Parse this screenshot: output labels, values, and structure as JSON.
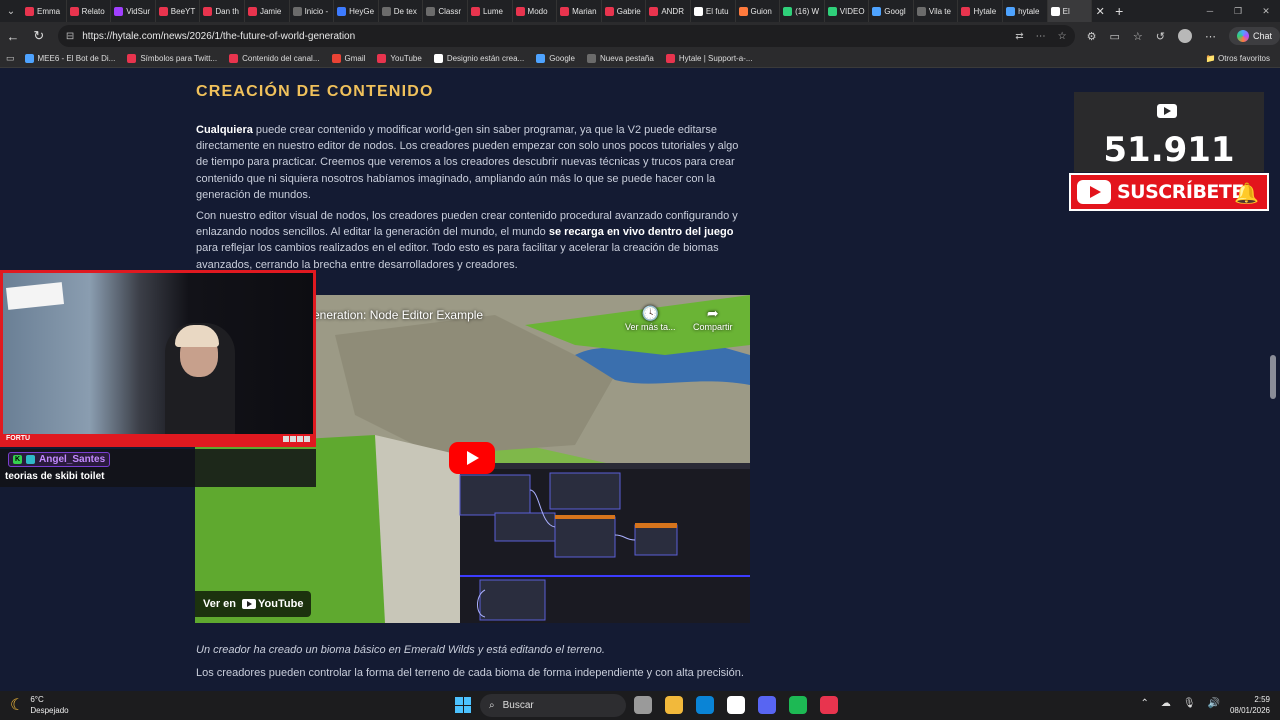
{
  "browser": {
    "tabs": [
      {
        "label": "Emma",
        "color": "#e8344e"
      },
      {
        "label": "Relato",
        "color": "#e8344e"
      },
      {
        "label": "VidSur",
        "color": "#a13fff"
      },
      {
        "label": "BeeYT",
        "color": "#e8344e"
      },
      {
        "label": "Dan th",
        "color": "#e8344e"
      },
      {
        "label": "Jamie",
        "color": "#e8344e"
      },
      {
        "label": "Inicio -",
        "color": "#6b6b6b"
      },
      {
        "label": "HeyGe",
        "color": "#3d7bff"
      },
      {
        "label": "De tex",
        "color": "#6b6b6b"
      },
      {
        "label": "Classr",
        "color": "#6b6b6b"
      },
      {
        "label": "Lume",
        "color": "#e8344e"
      },
      {
        "label": "Modo",
        "color": "#e8344e"
      },
      {
        "label": "Marian",
        "color": "#e8344e"
      },
      {
        "label": "Gabrie",
        "color": "#e8344e"
      },
      {
        "label": "ANDR",
        "color": "#e8344e"
      },
      {
        "label": "El futu",
        "color": "#ffffff"
      },
      {
        "label": "Guion",
        "color": "#ff7a3d"
      },
      {
        "label": "(16) W",
        "color": "#2fd07a"
      },
      {
        "label": "VIDEO",
        "color": "#2fd07a"
      },
      {
        "label": "Googl",
        "color": "#4ea3ff"
      },
      {
        "label": "Vila te",
        "color": "#6b6b6b"
      },
      {
        "label": "Hytale",
        "color": "#e8344e"
      },
      {
        "label": "hytale",
        "color": "#4ea3ff"
      },
      {
        "label": "El",
        "color": "#ffffff"
      }
    ],
    "url": "https://hytale.com/news/2026/1/the-future-of-world-generation",
    "chat_label": "Chat",
    "bookmarks": [
      {
        "label": "MEE6 - El Bot de Di...",
        "color": "#4ea3ff"
      },
      {
        "label": "Símbolos para Twitt...",
        "color": "#e8344e"
      },
      {
        "label": "Contenido del canal...",
        "color": "#e8344e"
      },
      {
        "label": "Gmail",
        "color": "#ea4335"
      },
      {
        "label": "YouTube",
        "color": "#e8344e"
      },
      {
        "label": "Designio están crea...",
        "color": "#ffffff"
      },
      {
        "label": "Google",
        "color": "#4ea3ff"
      },
      {
        "label": "Nueva pestaña",
        "color": "#6b6b6b"
      },
      {
        "label": "Hytale | Support-a-...",
        "color": "#e8344e"
      }
    ],
    "other_favorites": "Otros favoritos"
  },
  "article": {
    "heading": "CREACIÓN DE CONTENIDO",
    "para1_bold": "Cualquiera",
    "para1_rest": " puede crear contenido y modificar world-gen sin saber programar, ya que la V2 puede editarse directamente en nuestro editor de nodos. Los creadores pueden empezar con solo unos pocos tutoriales y algo de tiempo para practicar. Creemos que veremos a los creadores descubrir nuevas técnicas y trucos para crear contenido que ni siquiera nosotros habíamos imaginado, ampliando aún más lo que se puede hacer con la generación de mundos.",
    "para2_a": "Con nuestro editor visual de nodos, los creadores pueden crear contenido procedural avanzado configurando y enlazando nodos sencillos. Al editar la generación del mundo, el mundo ",
    "para2_bold": "se recarga en vivo dentro del juego",
    "para2_b": " para reflejar los cambios realizados en el editor. Todo esto es para facilitar y acelerar la creación de biomas avanzados, cerrando la brecha entre desarrolladores y creadores.",
    "caption": "Un creador ha creado un bioma básico en Emerald Wilds y está editando el terreno.",
    "para3": "Los creadores pueden controlar la forma del terreno de cada bioma de forma independiente y con alta precisión."
  },
  "video": {
    "title": "eneration: Node Editor Example",
    "watch_later": "Ver más ta...",
    "share": "Compartir",
    "watch_on": "Ver en",
    "yt_brand": "YouTube"
  },
  "stream": {
    "cam_label": "FORTU",
    "chat_user": "Angel_Santes",
    "chat_msg": "teorias de skibi toilet",
    "sub_count": "51.911",
    "subscribe": "SUSCRÍBETE"
  },
  "taskbar": {
    "temp": "6°C",
    "weather": "Despejado",
    "search": "Buscar",
    "time": "2:59",
    "date": "08/01/2026",
    "app_colors": [
      "#9a9a9a",
      "#f2b93b",
      "#0a84d6",
      "#ffffff",
      "#5865f2",
      "#1db954",
      "#e8344e"
    ]
  }
}
